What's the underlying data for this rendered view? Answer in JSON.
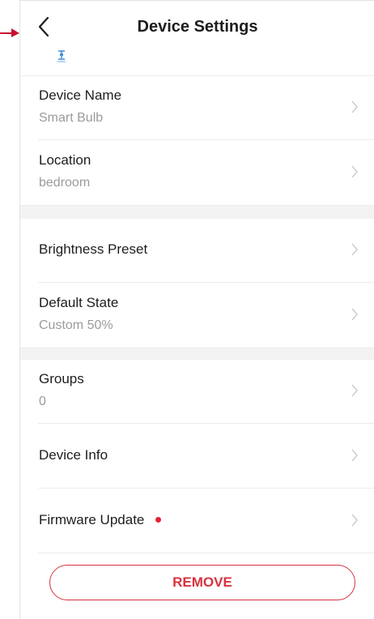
{
  "header": {
    "title": "Device Settings",
    "back_icon": "chevron-left-icon",
    "device_icon": "bulb-icon"
  },
  "sections": {
    "device_name": {
      "label": "Device Name",
      "value": "Smart Bulb"
    },
    "location": {
      "label": "Location",
      "value": "bedroom"
    },
    "brightness_preset": {
      "label": "Brightness Preset"
    },
    "default_state": {
      "label": "Default State",
      "value": "Custom 50%"
    },
    "groups": {
      "label": "Groups",
      "value": "0"
    },
    "device_info": {
      "label": "Device Info"
    },
    "firmware_update": {
      "label": "Firmware Update",
      "has_update_badge": true
    }
  },
  "actions": {
    "remove_label": "REMOVE"
  },
  "colors": {
    "accent_red": "#d8323f",
    "badge_red": "#e8213a",
    "annotation_arrow": "#c8102e",
    "device_icon_blue": "#4a90d9"
  }
}
